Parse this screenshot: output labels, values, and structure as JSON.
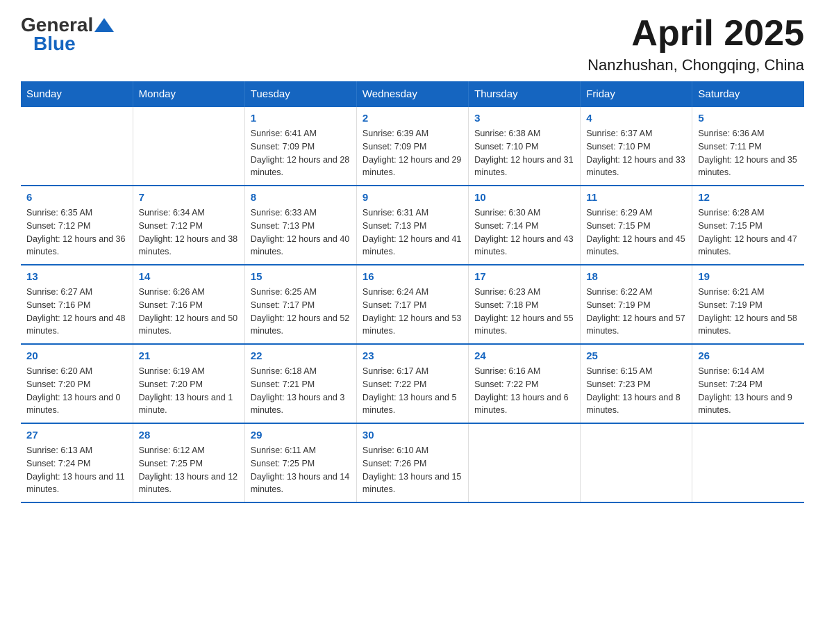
{
  "header": {
    "logo_general": "General",
    "logo_blue": "Blue",
    "title": "April 2025",
    "subtitle": "Nanzhushan, Chongqing, China"
  },
  "weekdays": [
    "Sunday",
    "Monday",
    "Tuesday",
    "Wednesday",
    "Thursday",
    "Friday",
    "Saturday"
  ],
  "weeks": [
    [
      {
        "day": "",
        "sunrise": "",
        "sunset": "",
        "daylight": ""
      },
      {
        "day": "",
        "sunrise": "",
        "sunset": "",
        "daylight": ""
      },
      {
        "day": "1",
        "sunrise": "Sunrise: 6:41 AM",
        "sunset": "Sunset: 7:09 PM",
        "daylight": "Daylight: 12 hours and 28 minutes."
      },
      {
        "day": "2",
        "sunrise": "Sunrise: 6:39 AM",
        "sunset": "Sunset: 7:09 PM",
        "daylight": "Daylight: 12 hours and 29 minutes."
      },
      {
        "day": "3",
        "sunrise": "Sunrise: 6:38 AM",
        "sunset": "Sunset: 7:10 PM",
        "daylight": "Daylight: 12 hours and 31 minutes."
      },
      {
        "day": "4",
        "sunrise": "Sunrise: 6:37 AM",
        "sunset": "Sunset: 7:10 PM",
        "daylight": "Daylight: 12 hours and 33 minutes."
      },
      {
        "day": "5",
        "sunrise": "Sunrise: 6:36 AM",
        "sunset": "Sunset: 7:11 PM",
        "daylight": "Daylight: 12 hours and 35 minutes."
      }
    ],
    [
      {
        "day": "6",
        "sunrise": "Sunrise: 6:35 AM",
        "sunset": "Sunset: 7:12 PM",
        "daylight": "Daylight: 12 hours and 36 minutes."
      },
      {
        "day": "7",
        "sunrise": "Sunrise: 6:34 AM",
        "sunset": "Sunset: 7:12 PM",
        "daylight": "Daylight: 12 hours and 38 minutes."
      },
      {
        "day": "8",
        "sunrise": "Sunrise: 6:33 AM",
        "sunset": "Sunset: 7:13 PM",
        "daylight": "Daylight: 12 hours and 40 minutes."
      },
      {
        "day": "9",
        "sunrise": "Sunrise: 6:31 AM",
        "sunset": "Sunset: 7:13 PM",
        "daylight": "Daylight: 12 hours and 41 minutes."
      },
      {
        "day": "10",
        "sunrise": "Sunrise: 6:30 AM",
        "sunset": "Sunset: 7:14 PM",
        "daylight": "Daylight: 12 hours and 43 minutes."
      },
      {
        "day": "11",
        "sunrise": "Sunrise: 6:29 AM",
        "sunset": "Sunset: 7:15 PM",
        "daylight": "Daylight: 12 hours and 45 minutes."
      },
      {
        "day": "12",
        "sunrise": "Sunrise: 6:28 AM",
        "sunset": "Sunset: 7:15 PM",
        "daylight": "Daylight: 12 hours and 47 minutes."
      }
    ],
    [
      {
        "day": "13",
        "sunrise": "Sunrise: 6:27 AM",
        "sunset": "Sunset: 7:16 PM",
        "daylight": "Daylight: 12 hours and 48 minutes."
      },
      {
        "day": "14",
        "sunrise": "Sunrise: 6:26 AM",
        "sunset": "Sunset: 7:16 PM",
        "daylight": "Daylight: 12 hours and 50 minutes."
      },
      {
        "day": "15",
        "sunrise": "Sunrise: 6:25 AM",
        "sunset": "Sunset: 7:17 PM",
        "daylight": "Daylight: 12 hours and 52 minutes."
      },
      {
        "day": "16",
        "sunrise": "Sunrise: 6:24 AM",
        "sunset": "Sunset: 7:17 PM",
        "daylight": "Daylight: 12 hours and 53 minutes."
      },
      {
        "day": "17",
        "sunrise": "Sunrise: 6:23 AM",
        "sunset": "Sunset: 7:18 PM",
        "daylight": "Daylight: 12 hours and 55 minutes."
      },
      {
        "day": "18",
        "sunrise": "Sunrise: 6:22 AM",
        "sunset": "Sunset: 7:19 PM",
        "daylight": "Daylight: 12 hours and 57 minutes."
      },
      {
        "day": "19",
        "sunrise": "Sunrise: 6:21 AM",
        "sunset": "Sunset: 7:19 PM",
        "daylight": "Daylight: 12 hours and 58 minutes."
      }
    ],
    [
      {
        "day": "20",
        "sunrise": "Sunrise: 6:20 AM",
        "sunset": "Sunset: 7:20 PM",
        "daylight": "Daylight: 13 hours and 0 minutes."
      },
      {
        "day": "21",
        "sunrise": "Sunrise: 6:19 AM",
        "sunset": "Sunset: 7:20 PM",
        "daylight": "Daylight: 13 hours and 1 minute."
      },
      {
        "day": "22",
        "sunrise": "Sunrise: 6:18 AM",
        "sunset": "Sunset: 7:21 PM",
        "daylight": "Daylight: 13 hours and 3 minutes."
      },
      {
        "day": "23",
        "sunrise": "Sunrise: 6:17 AM",
        "sunset": "Sunset: 7:22 PM",
        "daylight": "Daylight: 13 hours and 5 minutes."
      },
      {
        "day": "24",
        "sunrise": "Sunrise: 6:16 AM",
        "sunset": "Sunset: 7:22 PM",
        "daylight": "Daylight: 13 hours and 6 minutes."
      },
      {
        "day": "25",
        "sunrise": "Sunrise: 6:15 AM",
        "sunset": "Sunset: 7:23 PM",
        "daylight": "Daylight: 13 hours and 8 minutes."
      },
      {
        "day": "26",
        "sunrise": "Sunrise: 6:14 AM",
        "sunset": "Sunset: 7:24 PM",
        "daylight": "Daylight: 13 hours and 9 minutes."
      }
    ],
    [
      {
        "day": "27",
        "sunrise": "Sunrise: 6:13 AM",
        "sunset": "Sunset: 7:24 PM",
        "daylight": "Daylight: 13 hours and 11 minutes."
      },
      {
        "day": "28",
        "sunrise": "Sunrise: 6:12 AM",
        "sunset": "Sunset: 7:25 PM",
        "daylight": "Daylight: 13 hours and 12 minutes."
      },
      {
        "day": "29",
        "sunrise": "Sunrise: 6:11 AM",
        "sunset": "Sunset: 7:25 PM",
        "daylight": "Daylight: 13 hours and 14 minutes."
      },
      {
        "day": "30",
        "sunrise": "Sunrise: 6:10 AM",
        "sunset": "Sunset: 7:26 PM",
        "daylight": "Daylight: 13 hours and 15 minutes."
      },
      {
        "day": "",
        "sunrise": "",
        "sunset": "",
        "daylight": ""
      },
      {
        "day": "",
        "sunrise": "",
        "sunset": "",
        "daylight": ""
      },
      {
        "day": "",
        "sunrise": "",
        "sunset": "",
        "daylight": ""
      }
    ]
  ]
}
